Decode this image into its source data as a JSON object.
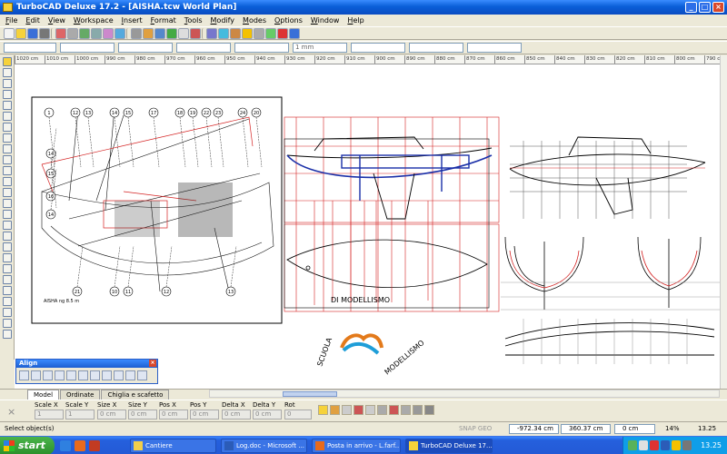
{
  "window": {
    "title": "TurboCAD Deluxe 17.2 - [AISHA.tcw World Plan]",
    "buttons": [
      "_",
      "□",
      "×"
    ]
  },
  "menu": [
    "File",
    "Edit",
    "View",
    "Workspace",
    "Insert",
    "Format",
    "Tools",
    "Modify",
    "Modes",
    "Options",
    "Window",
    "Help"
  ],
  "property_toolbar": {
    "line_width": "1 mm"
  },
  "ruler": {
    "ticks": [
      "1020 cm",
      "1010 cm",
      "1000 cm",
      "990 cm",
      "980 cm",
      "970 cm",
      "960 cm",
      "950 cm",
      "940 cm",
      "930 cm",
      "920 cm",
      "910 cm",
      "900 cm",
      "890 cm",
      "880 cm",
      "870 cm",
      "860 cm",
      "850 cm",
      "840 cm",
      "830 cm",
      "820 cm",
      "810 cm",
      "800 cm",
      "790 cm"
    ]
  },
  "drawing": {
    "callouts": [
      "1",
      "12",
      "13",
      "14",
      "15",
      "17",
      "18",
      "19",
      "22",
      "23",
      "24",
      "20",
      "21",
      "10",
      "11",
      "12",
      "13",
      "14",
      "15",
      "16",
      "14"
    ],
    "sheet_caption": "AISHA ng 8.5 m",
    "watermark": {
      "top_text": "DI  MODELLISMO",
      "side_text": "SCUOLA",
      "arc_text": "MODELLISMO"
    }
  },
  "align_palette": {
    "title": "Align"
  },
  "tabs": [
    {
      "label": "Model",
      "active": true
    },
    {
      "label": "Ordinate",
      "active": false
    },
    {
      "label": "Chiglia e scafetto",
      "active": false
    }
  ],
  "inspector": {
    "fields": [
      {
        "label": "Scale X",
        "value": "1"
      },
      {
        "label": "Scale Y",
        "value": "1"
      },
      {
        "label": "Size X",
        "value": "0 cm"
      },
      {
        "label": "Size Y",
        "value": "0 cm"
      },
      {
        "label": "Pos X",
        "value": "0 cm"
      },
      {
        "label": "Pos Y",
        "value": "0 cm"
      },
      {
        "label": "Delta X",
        "value": "0 cm"
      },
      {
        "label": "Delta Y",
        "value": "0 cm"
      },
      {
        "label": "Rot",
        "value": "0"
      }
    ]
  },
  "status": {
    "message": "Select object(s)",
    "snap": "SNAP GEO",
    "x": "-972.34 cm",
    "y": "360.37 cm",
    "z": "0 cm",
    "zoom": "14%",
    "value": "13.25"
  },
  "taskbar": {
    "start": "start",
    "tasks": [
      "Cantiere",
      "Log.doc - Microsoft ...",
      "Posta in arrivo - L.farf...",
      "TurboCAD Deluxe 17...."
    ],
    "clock": "13.25"
  },
  "colors": {
    "xp_blue": "#0a5fd8",
    "start_green": "#2b8f2b",
    "drawing_red": "#d42020",
    "drawing_blue": "#1a2fa8"
  }
}
